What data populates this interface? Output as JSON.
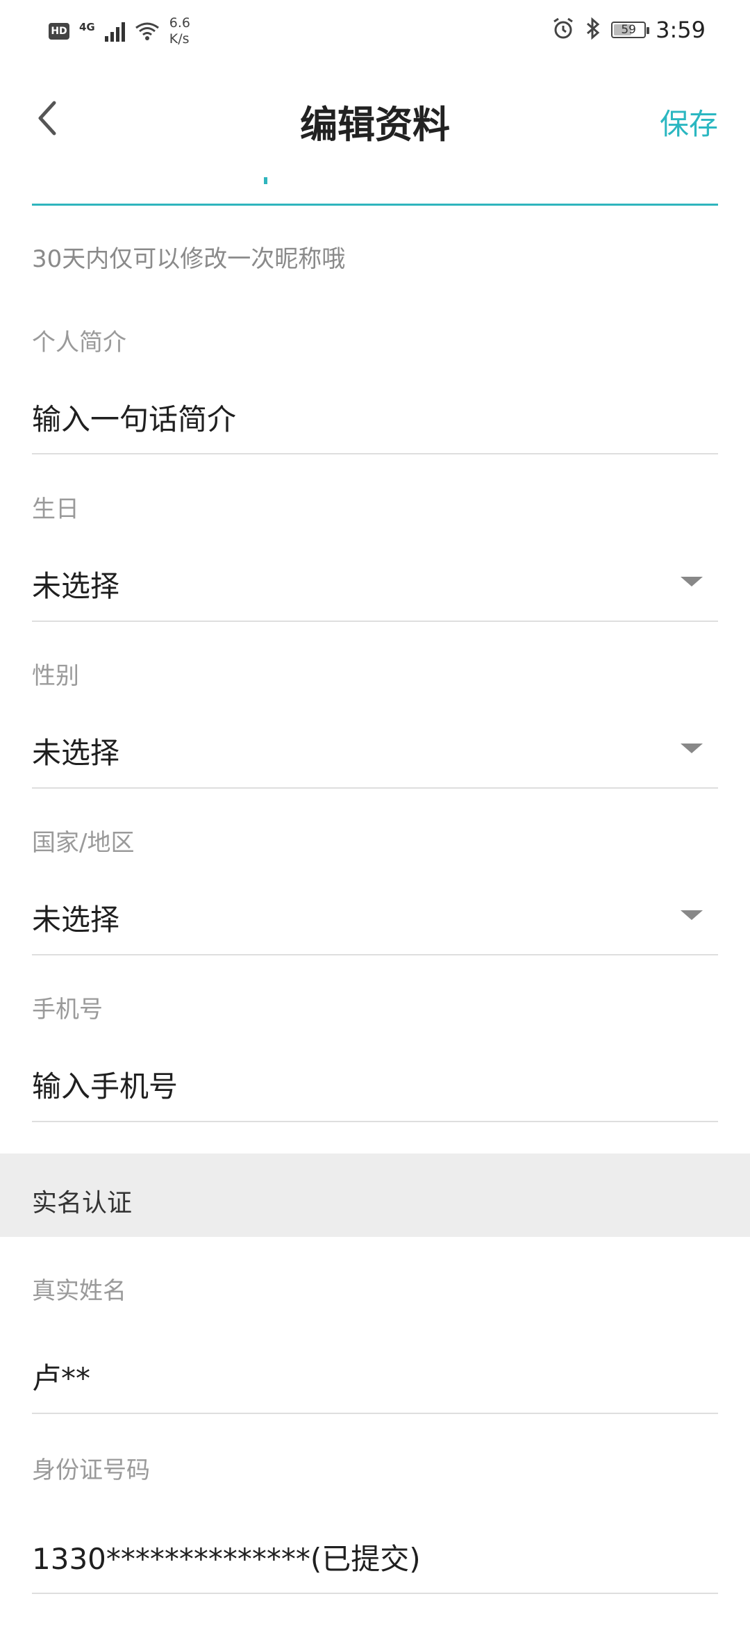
{
  "status_bar": {
    "hd": "HD",
    "network": "4G",
    "speed_value": "6.6",
    "speed_unit": "K/s",
    "battery": "59",
    "battery_level": 0.59,
    "time": "3:59"
  },
  "header": {
    "title": "编辑资料",
    "save_label": "保存",
    "back_icon": "chevron-left-icon"
  },
  "nickname": {
    "hint": "30天内仅可以修改一次昵称哦",
    "accent_color": "#2fb5bd"
  },
  "fields": {
    "bio": {
      "label": "个人简介",
      "placeholder": "输入一句话简介"
    },
    "birthday": {
      "label": "生日",
      "value": "未选择"
    },
    "gender": {
      "label": "性别",
      "value": "未选择"
    },
    "region": {
      "label": "国家/地区",
      "value": "未选择"
    },
    "phone": {
      "label": "手机号",
      "placeholder": "输入手机号"
    }
  },
  "verification": {
    "section_title": "实名认证",
    "real_name": {
      "label": "真实姓名",
      "value": "卢**"
    },
    "id_number": {
      "label": "身份证号码",
      "value": "1330**************(已提交)"
    }
  },
  "colors": {
    "accent": "#2bb7c1",
    "section_bg": "#ededed",
    "divider": "#dedede"
  }
}
